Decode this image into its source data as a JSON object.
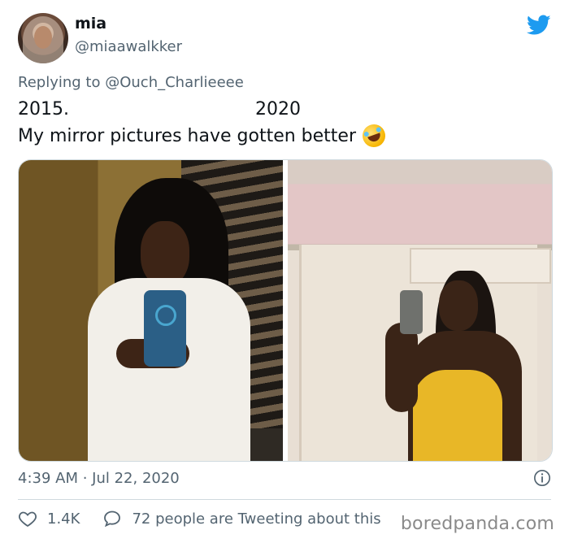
{
  "user": {
    "name": "mia",
    "handle": "@miaawalkker"
  },
  "reply": {
    "prefix": "Replying to",
    "mention": "@Ouch_Charlieeee"
  },
  "tweet": {
    "year_left": "2015.",
    "year_right": "2020",
    "text": "My mirror pictures have gotten better",
    "emoji": "rolling-on-the-floor-laughing-emoji"
  },
  "meta": {
    "timestamp": "4:39 AM · Jul 22, 2020"
  },
  "engagement": {
    "likes": "1.4K",
    "discussion": "72 people are Tweeting about this"
  },
  "watermark": "boredpanda.com",
  "colors": {
    "twitter_blue": "#1d9bf0",
    "secondary_text": "#536471"
  }
}
